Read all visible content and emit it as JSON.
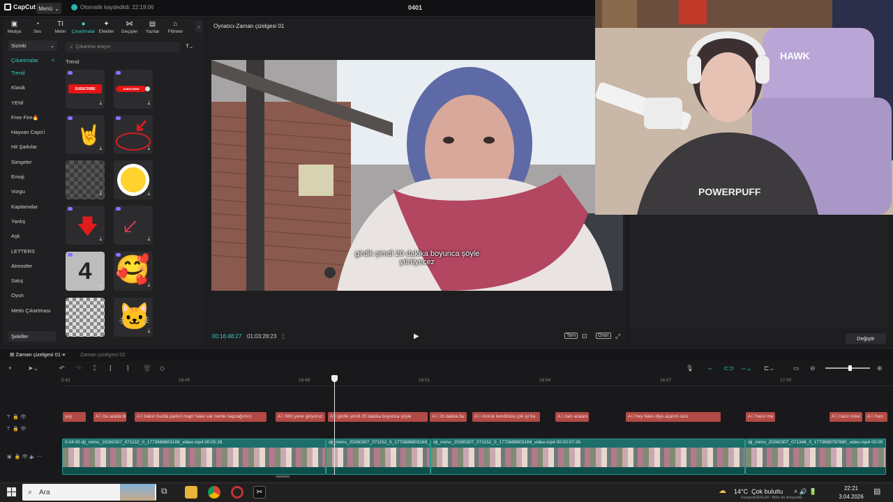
{
  "app": {
    "logo_text": "CapCut",
    "menu_label": "Menü",
    "autosave_text": "Otomatik kaydedildi: 22:19:06",
    "project_title": "0401"
  },
  "toolbar": {
    "tabs": [
      {
        "label": "Medya",
        "icon": "media-icon"
      },
      {
        "label": "Ses",
        "icon": "audio-icon"
      },
      {
        "label": "Metin",
        "icon": "text-icon"
      },
      {
        "label": "Çıkartmalar",
        "icon": "sticker-icon",
        "active": true
      },
      {
        "label": "Efektler",
        "icon": "effects-icon"
      },
      {
        "label": "Geçişler",
        "icon": "transitions-icon"
      },
      {
        "label": "Yazılar",
        "icon": "captions-icon"
      },
      {
        "label": "Filtreler",
        "icon": "filters-icon"
      }
    ]
  },
  "categories": {
    "dropdown_top": "Sizinki",
    "dropdown_section": "Çıkartmalar",
    "items": [
      "Trend",
      "Klasik",
      "YENİ",
      "Free Fire🔥",
      "Hayvan Caps'i",
      "Hit Şarkılar",
      "Simgeler",
      "Emoji",
      "Vurgu",
      "Kaplamalar",
      "Yanlış",
      "Aşk",
      "LETTERS",
      "Atmosfer",
      "Satış",
      "Oyun",
      "Metin Çıkartması"
    ],
    "active_index": 0,
    "bottom_item": "Şekiller"
  },
  "sticker_panel": {
    "search_placeholder": "Çıkartma arayın",
    "section_heading": "Trend",
    "sticker_texts": {
      "subscribe1": "SUBSCRIBE",
      "subscribe2": "SUBSCRIBE",
      "countdown": "4"
    }
  },
  "player": {
    "title": "Oynatıcı-Zaman çizelgesi 01",
    "subtitle_line1": "girdik şimdi 20 dakika boyunca şöyle",
    "subtitle_line2": "yürüyecez",
    "timecode_current": "00:16:48:27",
    "timecode_total": "01:03:28:23",
    "controls": {
      "full_label": "Tam",
      "ratio_label": "Oran"
    }
  },
  "right_panel": {
    "change_button": "Değiştir"
  },
  "timeline": {
    "tab_active": "Zaman çizelgesi 01",
    "tab_inactive": "Zaman çizelgesi 02",
    "ruler_labels": [
      "5:42",
      "16:45",
      "16:48",
      "16:51",
      "16:54",
      "16:57",
      "17:00"
    ],
    "text_clips": [
      "şey",
      "bu arada bilet",
      "bakın burda parkın map'i falan var nerde napcağımızı",
      "600 yene giriyoruz",
      "girdik şimdi 20 dakika boyunca şöyle",
      "20 dakka bu",
      "moruk kendinize çok iyi ba",
      "ben aralarıı",
      "hey falan diye açarım size",
      "hazır me",
      "hazır mise",
      "hazı"
    ],
    "video_clips": [
      {
        "name": "dji_mimo_20260307_071152_0_1773688803169_video.mp4",
        "duration": "00:05:28",
        "prefix": "0:04:00"
      },
      {
        "name": "dji_mimo_20260307_071152_0_1773688803169_v",
        "duration": ""
      },
      {
        "name": "dji_mimo_20260307_071152_0_1773688803169_video.mp4",
        "duration": "00:00:07:26"
      },
      {
        "name": "dji_mimo_20260307_071346_0_1773688787880_video.mp4",
        "duration": "00:00"
      }
    ]
  },
  "taskbar": {
    "search_placeholder": "Ara",
    "weather_temp": "14°C",
    "weather_desc": "Çok bulutlu",
    "weather_sub": "DungeonDERLER : Birko da olmuyordu",
    "time": "22:21",
    "date": "3.04.2026"
  },
  "colors": {
    "accent": "#2ed3c6",
    "text_clip": "#b24a45",
    "video_clip": "#1c6f6a"
  }
}
